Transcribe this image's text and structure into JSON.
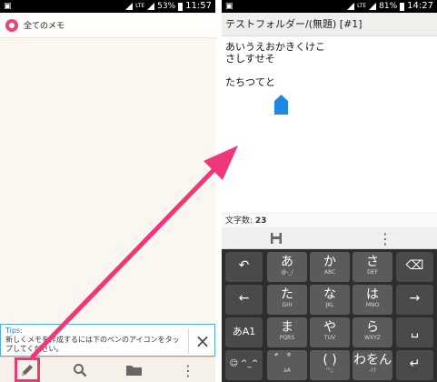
{
  "left_screen": {
    "status_bar": {
      "network": "LTE",
      "battery": "53%",
      "time": "11:57"
    },
    "header": {
      "title": "全てのメモ"
    },
    "tips": {
      "label": "Tips:",
      "text": "新しくメモを作成するには下のペンのアイコンをタップしてください。",
      "close_icon": "×"
    },
    "toolbar": {
      "items": [
        {
          "icon": "pen-icon",
          "glyph": "✎"
        },
        {
          "icon": "search-icon",
          "glyph": "⚲"
        },
        {
          "icon": "folder-icon",
          "glyph": ""
        },
        {
          "icon": "more-vert-icon",
          "glyph": "⋮"
        }
      ]
    }
  },
  "right_screen": {
    "status_bar": {
      "network": "LTE",
      "battery": "81%",
      "time": "14:27"
    },
    "header": {
      "title": "テストフォルダー/(無題) [#1]"
    },
    "memo_lines": [
      "あいうえおかきくけこ",
      "さしすせそ",
      "",
      "たちつてと"
    ],
    "char_count": {
      "label": "文字数:",
      "value": "23"
    },
    "toolbar": {
      "items": [
        {
          "icon": "save-icon",
          "glyph": ""
        },
        {
          "icon": "more-vert-icon",
          "glyph": "⋮"
        }
      ]
    },
    "keyboard": {
      "rows": [
        {
          "left": "↶",
          "kana": [
            [
              "あ",
              "@-_/"
            ],
            [
              "か",
              "ABC"
            ],
            [
              "さ",
              "DEF"
            ]
          ],
          "right": "⌫"
        },
        {
          "left": "←",
          "kana": [
            [
              "た",
              "GHI"
            ],
            [
              "な",
              "JKL"
            ],
            [
              "は",
              "MNO"
            ]
          ],
          "right": "→"
        },
        {
          "left": "あA1",
          "kana": [
            [
              "ま",
              "PQRS"
            ],
            [
              "や",
              "TUV"
            ],
            [
              "ら",
              "WXYZ"
            ]
          ],
          "right": "␣"
        },
        {
          "left": "☺ ^_^",
          "kana": [
            [
              "゛゜",
              "aA"
            ],
            [
              "( )",
              "'\":;"
            ],
            [
              "わをん",
              "-!?"
            ]
          ],
          "right": "↵"
        }
      ]
    }
  },
  "colors": {
    "accent": "#f0377a",
    "tips_border": "#4ab1e4",
    "handle": "#1e88e5"
  }
}
